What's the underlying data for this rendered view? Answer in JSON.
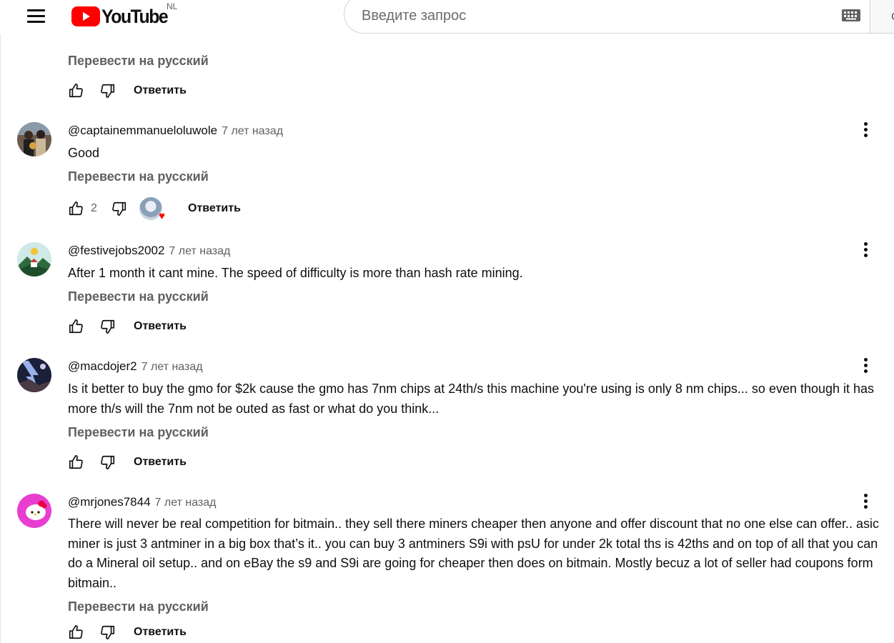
{
  "header": {
    "logo_text": "YouTube",
    "country_code": "NL",
    "search_placeholder": "Введите запрос",
    "brand_color": "#ff0000"
  },
  "partial_comment": {
    "translate_label": "Перевести на русский",
    "reply_label": "Ответить"
  },
  "comments": [
    {
      "author": "@captainemmanueloluwole",
      "time": "7 лет назад",
      "text": "Good",
      "translate_label": "Перевести на русский",
      "likes": "2",
      "creator_heart": true,
      "reply_label": "Ответить"
    },
    {
      "author": "@festivejobs2002",
      "time": "7 лет назад",
      "text": "After 1 month it cant mine. The speed of difficulty is more than hash rate mining.",
      "translate_label": "Перевести на русский",
      "likes": "",
      "reply_label": "Ответить"
    },
    {
      "author": "@macdojer2",
      "time": "7 лет назад",
      "text": "Is it better to buy the gmo for $2k cause the gmo has 7nm chips at 24th/s this machine you're using is only 8 nm chips... so even though it has more th/s will the 7nm not be outed as fast or what do you think...",
      "translate_label": "Перевести на русский",
      "likes": "",
      "reply_label": "Ответить"
    },
    {
      "author": "@mrjones7844",
      "time": "7 лет назад",
      "text": "There will never be real competition for bitmain.. they sell there miners cheaper then anyone and offer discount that no one else can offer.. asic miner is just 3 antminer in a big box that’s it.. you can buy 3 antminers S9i  with psU for under 2k total ths is 42ths and on top of all that you can do a Mineral oil setup.. and on eBay the s9 and S9i are going for cheaper then does on bitmain. Mostly becuz a lot of seller had coupons form bitmain..",
      "translate_label": "Перевести на русский",
      "likes": "",
      "reply_label": "Ответить"
    }
  ]
}
